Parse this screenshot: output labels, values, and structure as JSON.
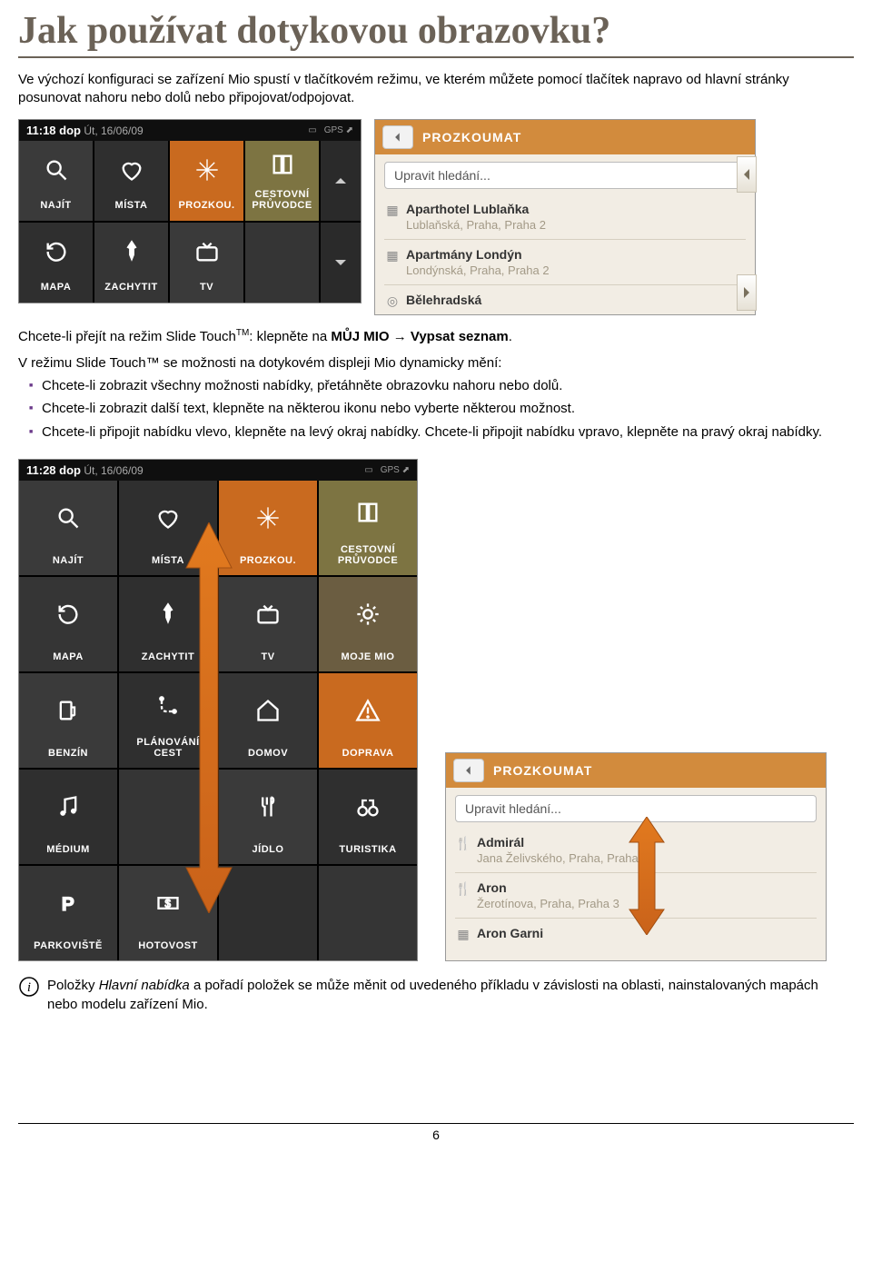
{
  "heading": "Jak používat dotykovou obrazovku?",
  "intro": "Ve výchozí konfiguraci se zařízení Mio spustí v tlačítkovém režimu, ve kterém můžete pomocí tlačítek napravo od hlavní stránky posunovat nahoru nebo dolů nebo připojovat/odpojovat.",
  "phone1": {
    "clock_bold": "11:18 dop",
    "clock_rest": "Út, 16/06/09",
    "gps_label": "GPS",
    "tiles": [
      {
        "label": "NAJÍT",
        "cls": "lightgrey",
        "icon": "search"
      },
      {
        "label": "MÍSTA",
        "cls": "charcoal",
        "icon": "heart"
      },
      {
        "label": "PROZKOU.",
        "cls": "orange",
        "icon": "sparkle"
      },
      {
        "label": "CESTOVNÍ PRŮVODCE",
        "cls": "olive",
        "icon": "book"
      },
      {
        "label": "MAPA",
        "cls": "charcoal",
        "icon": "loop"
      },
      {
        "label": "ZACHYTIT",
        "cls": "midgrey",
        "icon": "pin"
      },
      {
        "label": "TV",
        "cls": "lightgrey",
        "icon": "tv"
      },
      {
        "label": "",
        "cls": "midgrey",
        "icon": ""
      }
    ]
  },
  "panel1": {
    "title": "PROZKOUMAT",
    "search_placeholder": "Upravit hledání...",
    "items": [
      {
        "icon": "grid",
        "t1": "Aparthotel Lublaňka",
        "t2": "Lublaňská, Praha, Praha 2"
      },
      {
        "icon": "grid",
        "t1": "Apartmány Londýn",
        "t2": "Londýnská, Praha, Praha 2"
      },
      {
        "icon": "target",
        "t1": "Bělehradská",
        "t2": ""
      }
    ]
  },
  "mid1_pre": "Chcete-li přejít na režim Slide Touch",
  "mid1_tm": "TM",
  "mid1_mid": ": klepněte na ",
  "mid1_bold1": "MŮJ MIO",
  "mid1_arrow": " → ",
  "mid1_bold2": "Vypsat seznam",
  "mid1_end": ".",
  "mid2": "V režimu Slide Touch™ se možnosti na dotykovém displeji Mio dynamicky mění:",
  "bullets": [
    "Chcete-li zobrazit všechny možnosti nabídky, přetáhněte obrazovku nahoru nebo dolů.",
    "Chcete-li zobrazit další text, klepněte na některou ikonu nebo vyberte některou možnost.",
    "Chcete-li připojit nabídku vlevo, klepněte na levý okraj nabídky. Chcete-li připojit nabídku vpravo, klepněte na pravý okraj nabídky."
  ],
  "phone2": {
    "clock_bold": "11:28 dop",
    "clock_rest": "Út, 16/06/09",
    "gps_label": "GPS",
    "tiles": [
      {
        "label": "NAJÍT",
        "cls": "lightgrey",
        "icon": "search"
      },
      {
        "label": "MÍSTA",
        "cls": "charcoal",
        "icon": "heart"
      },
      {
        "label": "PROZKOU.",
        "cls": "orange",
        "icon": "sparkle"
      },
      {
        "label": "CESTOVNÍ PRŮVODCE",
        "cls": "olive",
        "icon": "book"
      },
      {
        "label": "MAPA",
        "cls": "midgrey",
        "icon": "loop"
      },
      {
        "label": "ZACHYTIT",
        "cls": "charcoal",
        "icon": "pin"
      },
      {
        "label": "TV",
        "cls": "lightgrey",
        "icon": "tv"
      },
      {
        "label": "MOJE MIO",
        "cls": "brown",
        "icon": "gear"
      },
      {
        "label": "BENZÍN",
        "cls": "lightgrey",
        "icon": "fuel"
      },
      {
        "label": "PLÁNOVÁNÍ CEST",
        "cls": "charcoal",
        "icon": "route"
      },
      {
        "label": "DOMOV",
        "cls": "midgrey",
        "icon": "home"
      },
      {
        "label": "DOPRAVA",
        "cls": "orange",
        "icon": "warn"
      },
      {
        "label": "MÉDIUM",
        "cls": "charcoal",
        "icon": "music"
      },
      {
        "label": "",
        "cls": "midgrey",
        "icon": ""
      },
      {
        "label": "JÍDLO",
        "cls": "lightgrey",
        "icon": "fork"
      },
      {
        "label": "TURISTIKA",
        "cls": "charcoal",
        "icon": "binoc"
      },
      {
        "label": "PARKOVIŠTĚ",
        "cls": "midgrey",
        "icon": "parking"
      },
      {
        "label": "HOTOVOST",
        "cls": "lightgrey",
        "icon": "cash"
      },
      {
        "label": "",
        "cls": "charcoal",
        "icon": ""
      },
      {
        "label": "",
        "cls": "midgrey",
        "icon": ""
      }
    ]
  },
  "panel2": {
    "title": "PROZKOUMAT",
    "search_placeholder": "Upravit hledání...",
    "items": [
      {
        "icon": "fork",
        "t1": "Admirál",
        "t2": "Jana Želivského, Praha, Praha 3"
      },
      {
        "icon": "fork",
        "t1": "Aron",
        "t2": "Žerotínova, Praha, Praha 3"
      },
      {
        "icon": "grid",
        "t1": "Aron Garni",
        "t2": ""
      }
    ]
  },
  "note_pre": "Položky ",
  "note_em": "Hlavní nabídka",
  "note_rest": " a pořadí položek se může měnit od uvedeného příkladu v závislosti na oblasti, nainstalovaných mapách nebo modelu zařízení Mio.",
  "page_number": "6"
}
